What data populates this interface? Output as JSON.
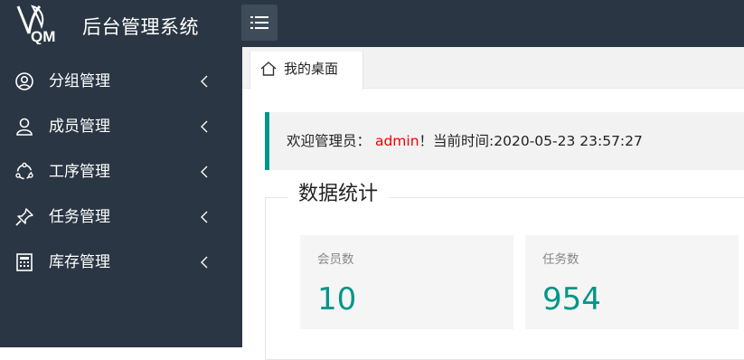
{
  "app": {
    "title": "后台管理系统",
    "logo_text": "QM"
  },
  "colors": {
    "topbar": "#2a3643",
    "accent": "#009688",
    "username": "#e00000"
  },
  "header": {
    "menu_icon": "list-icon"
  },
  "sidebar": {
    "items": [
      {
        "label": "分组管理",
        "icon": "user-circle-icon"
      },
      {
        "label": "成员管理",
        "icon": "user-icon"
      },
      {
        "label": "工序管理",
        "icon": "share-icon"
      },
      {
        "label": "任务管理",
        "icon": "pin-icon"
      },
      {
        "label": "库存管理",
        "icon": "calculator-icon"
      }
    ]
  },
  "tabs": [
    {
      "label": "我的桌面",
      "icon": "home-icon"
    }
  ],
  "welcome": {
    "prefix": "欢迎管理员：",
    "username": "admin",
    "suffix": "！当前时间:2020-05-23 23:57:27"
  },
  "stats": {
    "legend": "数据统计",
    "cards": [
      {
        "title": "会员数",
        "value": "10"
      },
      {
        "title": "任务数",
        "value": "954"
      }
    ]
  }
}
